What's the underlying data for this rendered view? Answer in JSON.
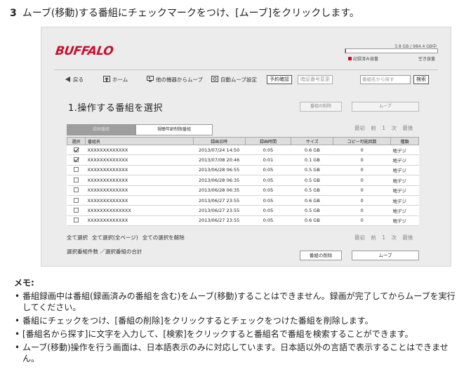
{
  "step": {
    "number": "3",
    "text": "ムーブ(移動)する番組にチェックマークをつけ、[ムーブ]をクリックします。"
  },
  "app": {
    "logo": "BUFFALO",
    "capacity": {
      "text": "3.8 GB / 984.4 GB中",
      "used_fraction": 0.004,
      "used_label": "記録済み容量",
      "free_label": "空き容量",
      "color": "#c8102e"
    },
    "nav": {
      "back": "戻る",
      "home": "ホーム",
      "move_from_other": "他の機器からムーブ",
      "auto_move": "自動ムーブ設定",
      "reservation": "予約確認",
      "pin_change": "暗証番号変更",
      "search_placeholder": "番組名から探す",
      "search_button": "検索"
    },
    "section_title": "1.操作する番組を選択",
    "buttons": {
      "delete": "番組の削除",
      "move": "ムーブ"
    },
    "tabs": [
      "録画番組",
      "視聴年齢制限番組"
    ],
    "pager": {
      "first": "最初",
      "prev": "前",
      "page": "1",
      "next": "次",
      "last": "最後"
    },
    "table": {
      "headers": [
        "選択",
        "番組名",
        "録画日時",
        "録画時間",
        "サイズ",
        "コピー可能回数",
        "種類"
      ],
      "rows": [
        {
          "checked": true,
          "name": "XXXXXXXXXXXXX",
          "date": "2013/07/24 14:50",
          "duration": "0:05",
          "size": "0.6 GB",
          "copies": "0",
          "type": "地デジ"
        },
        {
          "checked": true,
          "name": "XXXXXXXXXXXXX",
          "date": "2013/07/08 20:46",
          "duration": "0:01",
          "size": "0.1 GB",
          "copies": "0",
          "type": "地デジ"
        },
        {
          "checked": false,
          "name": "XXXXXXXXXXXXX",
          "date": "2013/06/28 06:55",
          "duration": "0:05",
          "size": "0.5 GB",
          "copies": "0",
          "type": "地デジ"
        },
        {
          "checked": false,
          "name": "XXXXXXXXXXXXX",
          "date": "2013/06/28 06:35",
          "duration": "0:05",
          "size": "0.5 GB",
          "copies": "0",
          "type": "地デジ"
        },
        {
          "checked": false,
          "name": "XXXXXXXXXXXXX",
          "date": "2013/06/28 06:35",
          "duration": "0:05",
          "size": "0.5 GB",
          "copies": "0",
          "type": "地デジ"
        },
        {
          "checked": false,
          "name": "XXXXXXXXXXXXX",
          "date": "2013/06/27 23:55",
          "duration": "0:05",
          "size": "0.6 GB",
          "copies": "0",
          "type": "地デジ"
        },
        {
          "checked": false,
          "name": "XXXXXXXXXXXXXX",
          "date": "2013/06/27 23:55",
          "duration": "0:05",
          "size": "0.5 GB",
          "copies": "0",
          "type": "地デジ"
        },
        {
          "checked": false,
          "name": "XXXXXXXXXXXXX",
          "date": "2013/06/27 23:55",
          "duration": "0:05",
          "size": "0.6 GB",
          "copies": "0",
          "type": "地デジ"
        }
      ]
    },
    "select_links": {
      "select_all": "全て選択",
      "select_all_pages": "全て選択(全ページ)",
      "clear_all": "全ての選択を解除"
    },
    "selection_summary": "選択番組件数 ／選択番組の合計"
  },
  "memo": {
    "title": "メモ:",
    "items": [
      "番組録画中は番組(録画済みの番組を含む)をムーブ(移動)することはできません。録画が完了してからムーブを実行してください。",
      "番組にチェックをつけ、[番組の削除]をクリックするとチェックをつけた番組を削除します。",
      "[番組名から探す]に文字を入力して、[検索]をクリックすると番組名で番組を検索することができます。",
      "ムーブ(移動)操作を行う画面は、日本語表示のみに対応しています。日本語以外の言語で表示することはできません。"
    ]
  }
}
